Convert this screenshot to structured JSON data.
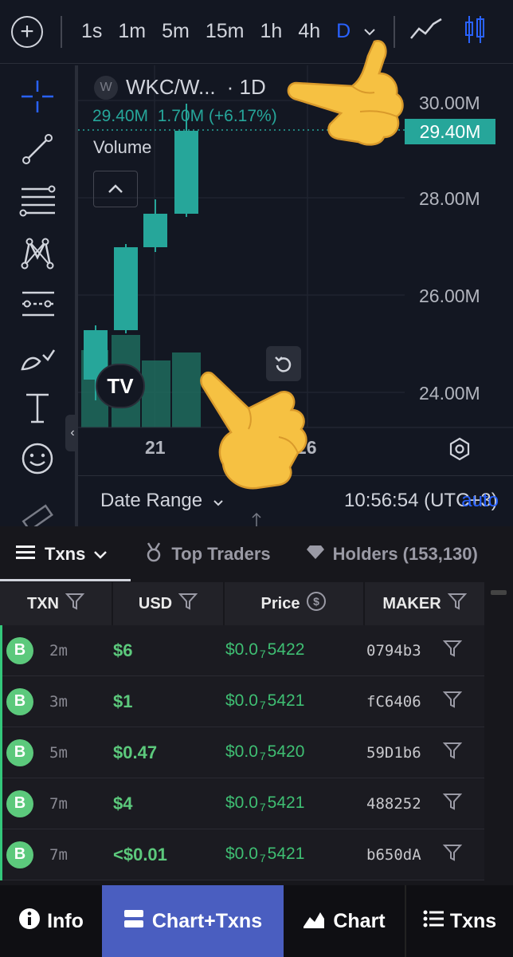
{
  "toolbar": {
    "timeframes": [
      "1s",
      "1m",
      "5m",
      "15m",
      "1h",
      "4h",
      "D"
    ],
    "active_timeframe": "D"
  },
  "legend": {
    "symbol_icon": "W",
    "symbol": "WKC/W...",
    "interval": "· 1D",
    "values": "29.40M  1.70M (+6.17%)",
    "volume_label": "Volume"
  },
  "price_axis": {
    "labels": [
      "30.00M",
      "28.00M",
      "26.00M",
      "24.00M"
    ],
    "last_price": "29.40M"
  },
  "time_axis": {
    "labels": [
      "21",
      "26"
    ]
  },
  "chart_footer": {
    "date_range": "Date Range",
    "time": "10:56:54 (UTC+3)",
    "auto": "auto"
  },
  "tabs": {
    "txns": "Txns",
    "top_traders": "Top Traders",
    "holders": "Holders (153,130)"
  },
  "table": {
    "headers": {
      "txn": "TXN",
      "usd": "USD",
      "price": "Price",
      "maker": "MAKER"
    },
    "rows": [
      {
        "type": "B",
        "age": "2m",
        "usd": "$6",
        "price_prefix": "$0.0",
        "price_sub": "7",
        "price_digits": "5422",
        "maker": "0794b3"
      },
      {
        "type": "B",
        "age": "3m",
        "usd": "$1",
        "price_prefix": "$0.0",
        "price_sub": "7",
        "price_digits": "5421",
        "maker": "fC6406"
      },
      {
        "type": "B",
        "age": "5m",
        "usd": "$0.47",
        "price_prefix": "$0.0",
        "price_sub": "7",
        "price_digits": "5420",
        "maker": "59D1b6"
      },
      {
        "type": "B",
        "age": "7m",
        "usd": "$4",
        "price_prefix": "$0.0",
        "price_sub": "7",
        "price_digits": "5421",
        "maker": "488252"
      },
      {
        "type": "B",
        "age": "7m",
        "usd": "<$0.01",
        "price_prefix": "$0.0",
        "price_sub": "7",
        "price_digits": "5421",
        "maker": "b650dA"
      }
    ]
  },
  "bottom_nav": {
    "info": "Info",
    "chart_txns": "Chart+Txns",
    "chart": "Chart",
    "txns": "Txns"
  },
  "colors": {
    "up": "#26a69a",
    "buy": "#5cc97c",
    "accent": "#2962ff",
    "nav_active": "#4a5ec0"
  }
}
